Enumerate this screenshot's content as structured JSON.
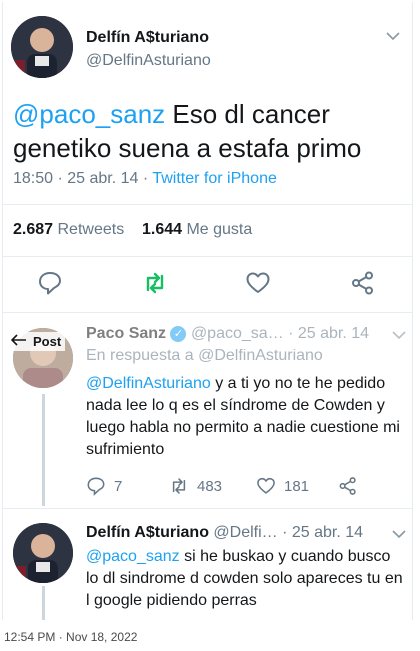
{
  "main_tweet": {
    "display_name": "Delfín A$turiano",
    "handle": "@DelfinAsturiano",
    "mention": "@paco_sanz",
    "text": " Eso dl cancer genetiko suena a estafa primo",
    "time": "18:50 · 25 abr. 14 · ",
    "source": "Twitter for iPhone",
    "retweets_count": "2.687",
    "retweets_label": " Retweets",
    "likes_count": "1.644",
    "likes_label": " Me gusta"
  },
  "overlay": {
    "back_label": "Post"
  },
  "reply_1": {
    "display_name": "Paco Sanz",
    "handle_time": "@paco_sa… · 25 abr. 14",
    "in_reply_to": "En respuesta a @DelfinAsturiano",
    "mention": "@DelfinAsturiano",
    "text": " y a ti yo no te he pedido nada lee lo q es el síndrome de Cowden y luego habla no permito a nadie cuestione mi sufrimiento",
    "replies": "7",
    "retweets": "483",
    "likes": "181"
  },
  "reply_2": {
    "display_name": "Delfín A$turiano",
    "handle_time": "@Delfi… · 25 abr. 14",
    "mention": "@paco_sanz",
    "text": " si he buskao y cuando busco lo dl sindrome d cowden solo apareces tu en l google pidiendo perras"
  },
  "footer": {
    "timestamp": "12:54 PM · Nov 18, 2022"
  },
  "colors": {
    "accent": "#1da1f2",
    "retweet_green": "#17bf63",
    "muted": "#657786"
  }
}
